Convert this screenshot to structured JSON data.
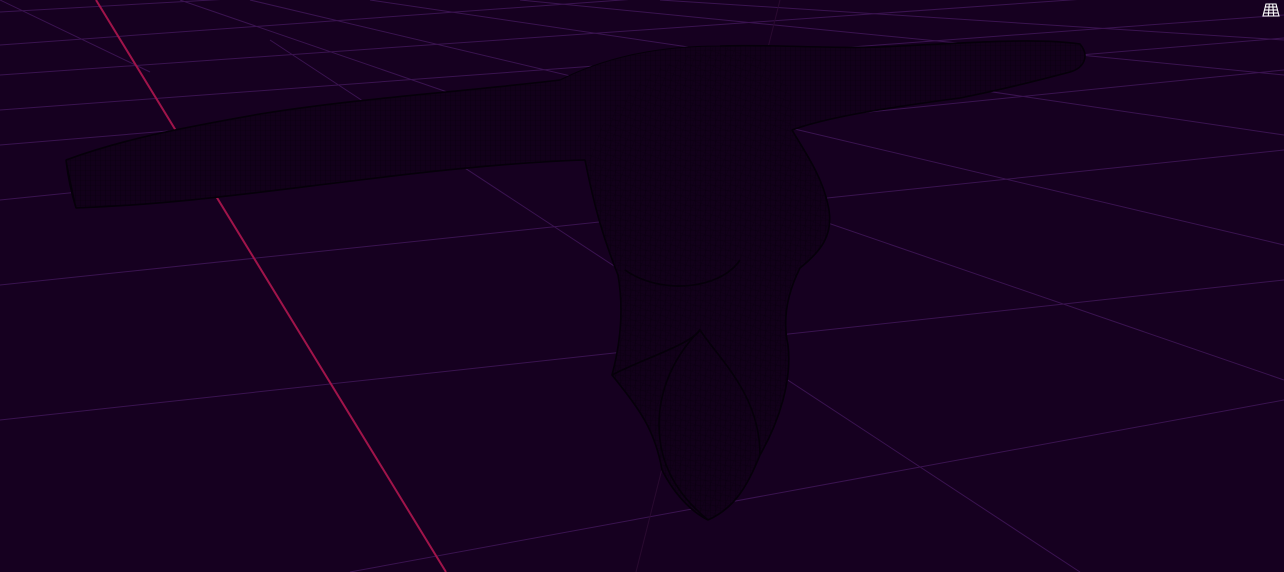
{
  "viewport": {
    "background_color": "#160020",
    "grid_color": "#3a1350",
    "x_axis_color": "#a0144a",
    "y_axis_color": "#2a0a30",
    "mesh_color": "#06000a",
    "mesh_fill_color": "#12001a"
  },
  "toolbar": {
    "wireframe_toggle_icon": "wireframe-grid-icon",
    "wireframe_mode": true
  }
}
